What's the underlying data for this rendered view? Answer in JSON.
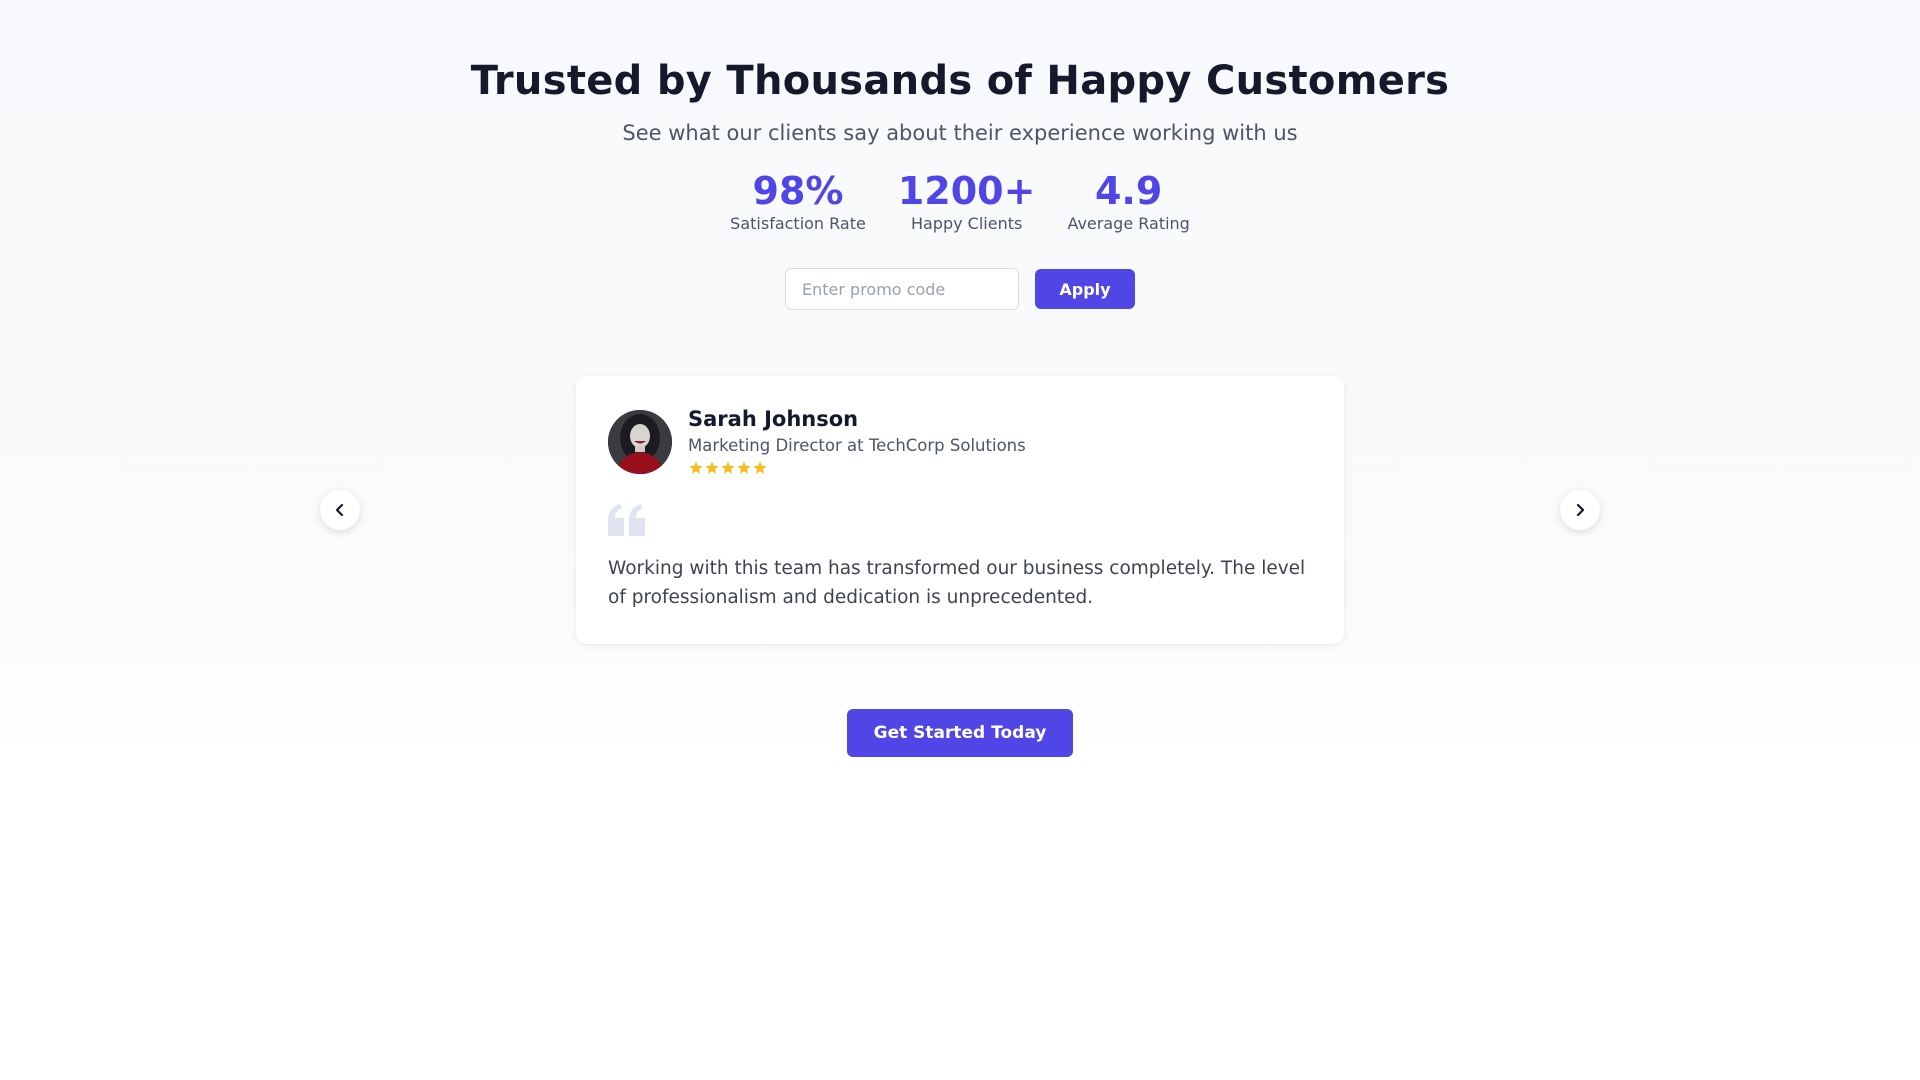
{
  "hero": {
    "title": "Trusted by Thousands of Happy Customers",
    "subtitle": "See what our clients say about their experience working with us"
  },
  "stats": [
    {
      "value": "98%",
      "label": "Satisfaction Rate"
    },
    {
      "value": "1200+",
      "label": "Happy Clients"
    },
    {
      "value": "4.9",
      "label": "Average Rating"
    }
  ],
  "promo": {
    "placeholder": "Enter promo code",
    "value": "",
    "apply_label": "Apply"
  },
  "testimonial": {
    "name": "Sarah Johnson",
    "role": "Marketing Director at TechCorp Solutions",
    "rating": 5,
    "rating_max": 5,
    "quote": "Working with this team has transformed our business completely. The level of professionalism and dedication is unprecedented."
  },
  "carousel": {
    "prev_icon": "chevron-left-icon",
    "next_icon": "chevron-right-icon"
  },
  "cta": {
    "label": "Get Started Today"
  },
  "colors": {
    "accent": "#4f46e5",
    "star": "#fbbf24",
    "title": "#141a2b",
    "muted": "#4d5566",
    "quote_mark": "#e0e3f0"
  }
}
